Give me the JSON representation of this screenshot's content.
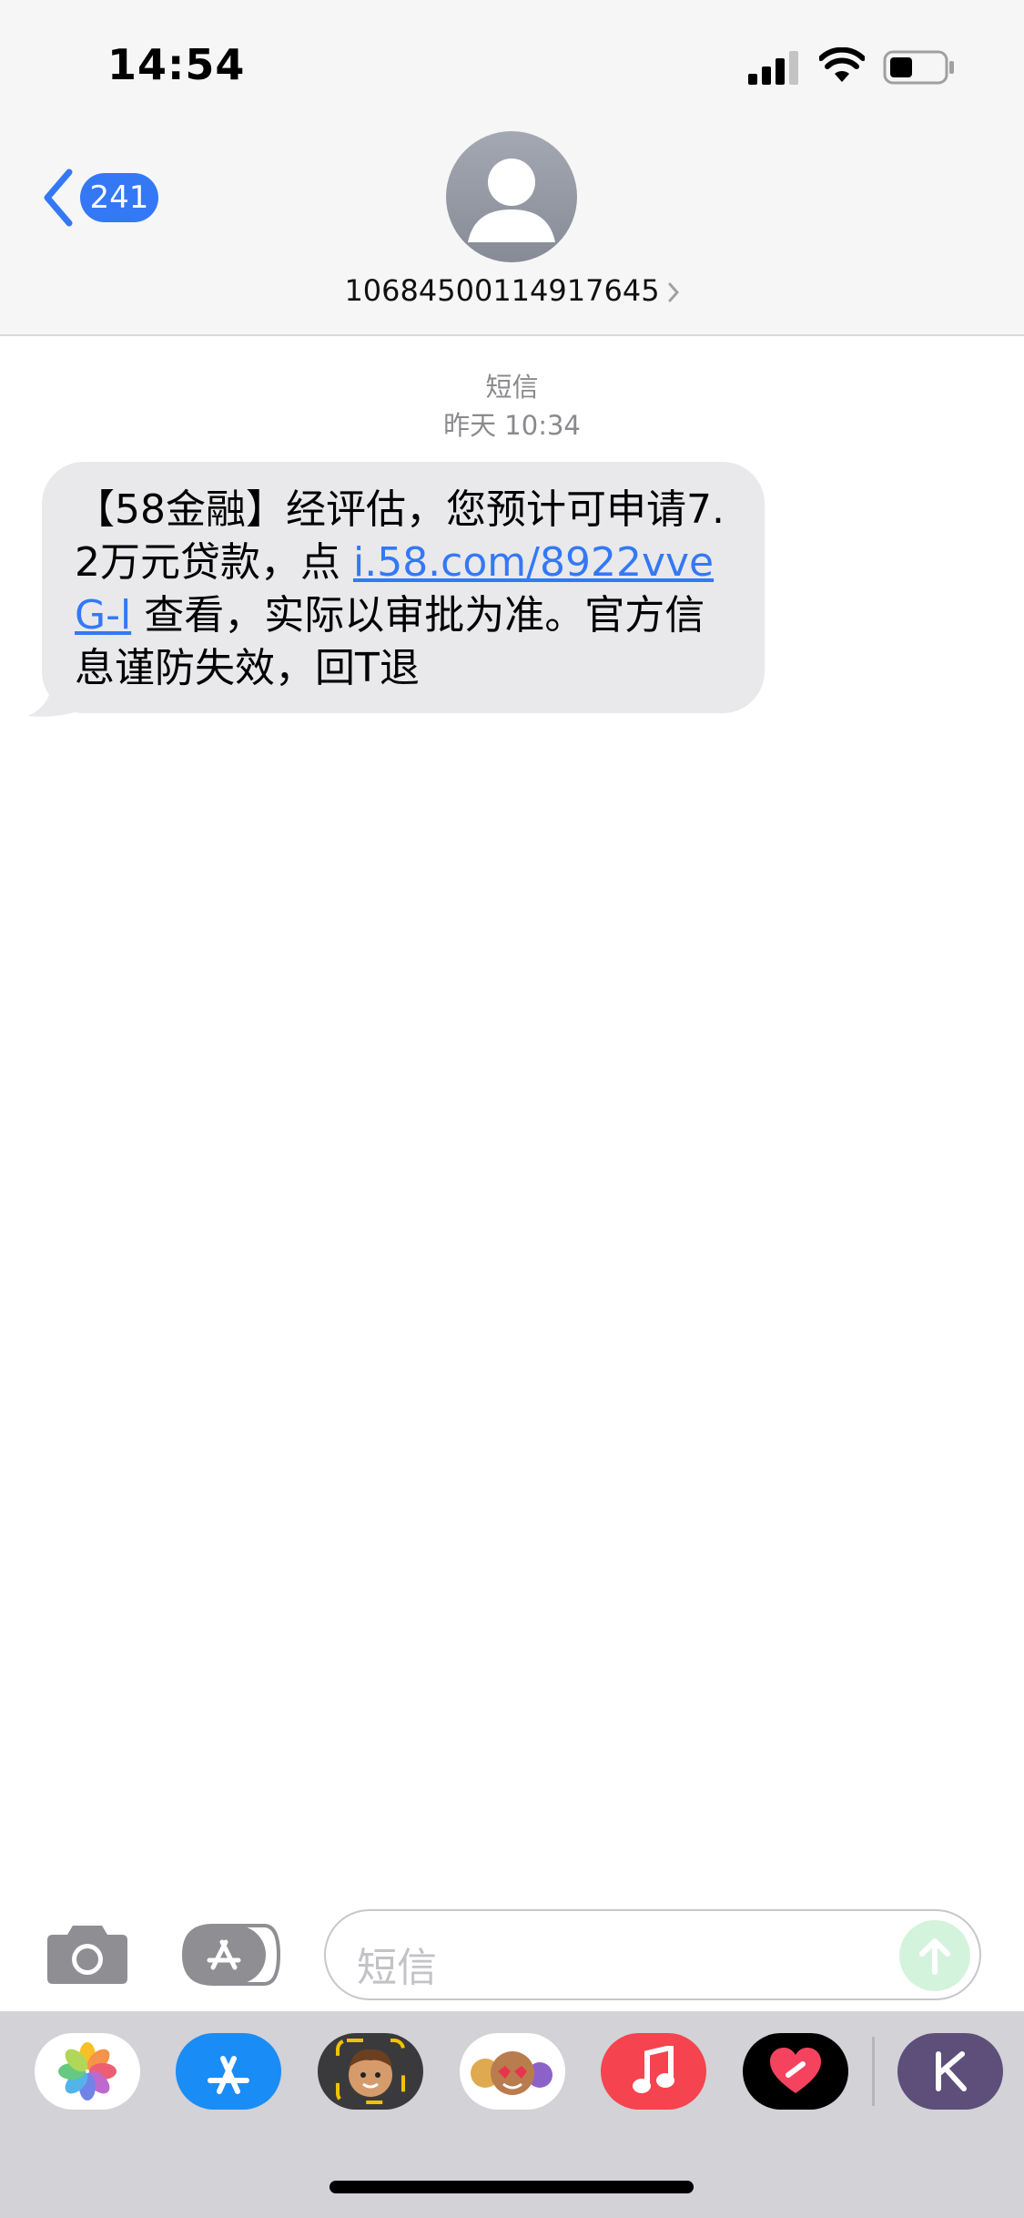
{
  "status_bar": {
    "time": "14:54"
  },
  "nav": {
    "back_count": "241",
    "contact_number": "10684500114917645"
  },
  "conversation": {
    "service_label": "短信",
    "timestamp": "昨天 10:34",
    "message": {
      "text_before": "【58金融】经评估，您预计可申请7.2万元贷款，点 ",
      "link": "i.58.com/8922vveG-l",
      "text_after": " 查看，实际以审批为准。官方信息谨防失效，回T退"
    }
  },
  "composer": {
    "placeholder": "短信"
  },
  "app_drawer": {
    "apps": [
      "photos-icon",
      "app-store-icon",
      "memoji-stickers-icon",
      "animoji-icon",
      "music-icon",
      "digital-touch-icon",
      "k-app-icon"
    ],
    "colors": {
      "app_store": "#1a8cf5",
      "music": "#f5434f",
      "digital_touch": "#000000",
      "k_app": "#5d4e7a"
    }
  },
  "colors": {
    "accent": "#3478f6",
    "bubble": "#e9e9eb",
    "header_bg": "#f6f6f6",
    "drawer_bg": "#d2d2d7"
  }
}
